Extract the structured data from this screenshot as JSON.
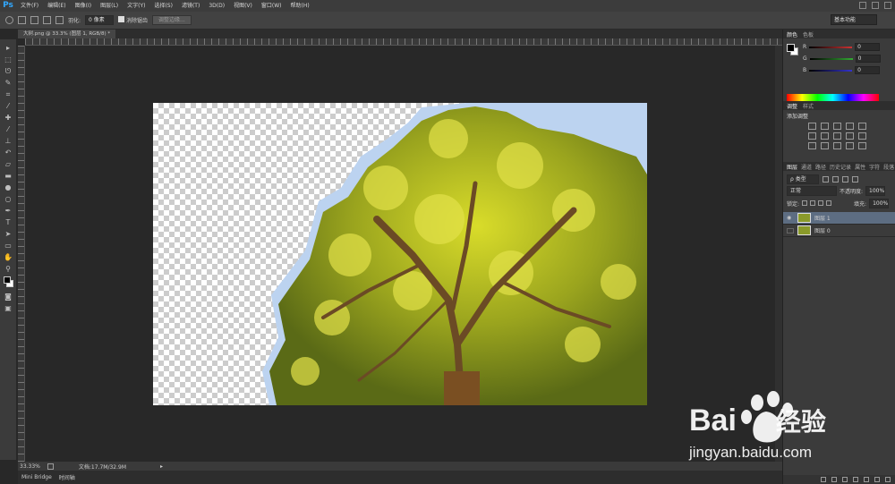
{
  "menubar": {
    "logo": "Ps",
    "items": [
      "文件(F)",
      "编辑(E)",
      "图像(I)",
      "图层(L)",
      "文字(Y)",
      "选择(S)",
      "滤镜(T)",
      "3D(D)",
      "视图(V)",
      "窗口(W)",
      "帮助(H)"
    ]
  },
  "options": {
    "feather_label": "羽化:",
    "feather_value": "0 像素",
    "antialias_label": "消除锯齿",
    "refine_edge_label": "调整边缘...",
    "workspace": "基本功能"
  },
  "document": {
    "tab_title": "大树.png @ 33.3% (图层 1, RGB/8) *",
    "zoom": "33.33%",
    "doc_size": "文档:17.7M/32.9M"
  },
  "bottom_tabs": [
    "Mini Bridge",
    "时间轴"
  ],
  "color_panel": {
    "tabs": [
      "颜色",
      "色板"
    ],
    "sliders": [
      {
        "label": "R",
        "value": "0",
        "color": "#c33"
      },
      {
        "label": "G",
        "value": "0",
        "color": "#3a3"
      },
      {
        "label": "B",
        "value": "0",
        "color": "#33c"
      }
    ]
  },
  "adjust_panel": {
    "tabs": [
      "调整",
      "样式"
    ],
    "title": "添加调整"
  },
  "layers_panel": {
    "tabs": [
      "图层",
      "通道",
      "路径",
      "历史记录",
      "属性",
      "字符",
      "段落"
    ],
    "filter_kind": "ρ 类型",
    "blend_mode": "正常",
    "opacity_label": "不透明度:",
    "opacity_value": "100%",
    "lock_label": "锁定:",
    "fill_label": "填充:",
    "fill_value": "100%",
    "layers": [
      {
        "name": "图层 1",
        "selected": true,
        "visible": true
      },
      {
        "name": "图层 0",
        "selected": false,
        "visible": false
      }
    ]
  },
  "watermark": {
    "brand": "Bai",
    "brand2": "经验",
    "url": "jingyan.baidu.com"
  }
}
